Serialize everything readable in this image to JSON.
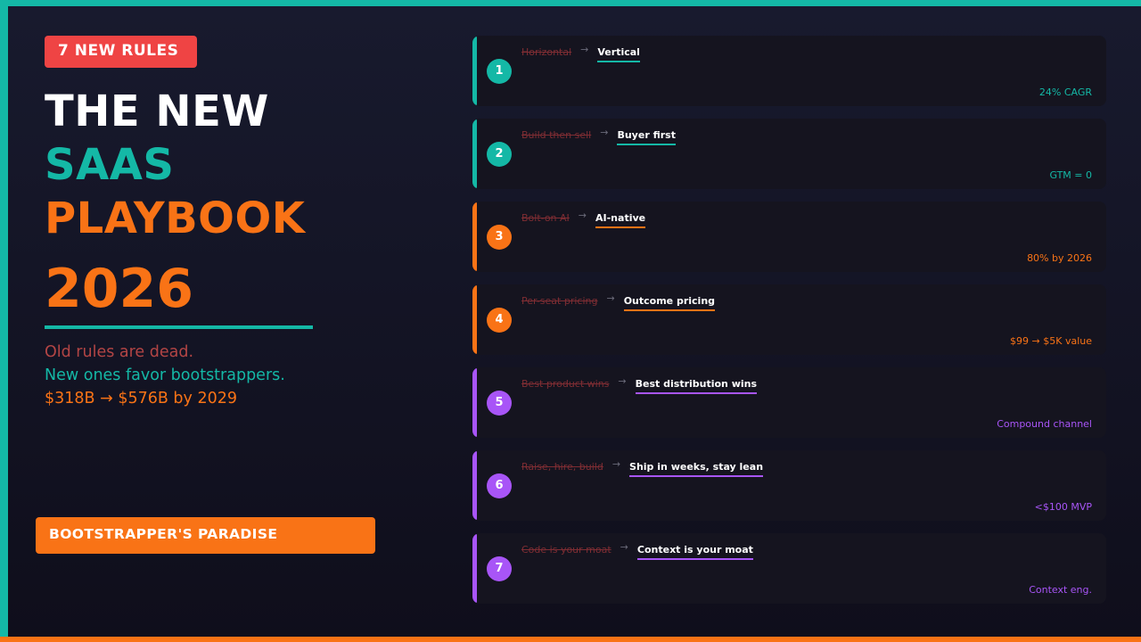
{
  "badge": "7 NEW RULES",
  "title": {
    "line1": "THE NEW",
    "line2": "SAAS",
    "line3": "PLAYBOOK",
    "year": "2026"
  },
  "subtitle": {
    "line1": "Old rules are dead.",
    "line2": "New ones favor bootstrappers.",
    "line3": "$318B → $576B by 2029"
  },
  "cta": "BOOTSTRAPPER'S PARADISE",
  "colors": {
    "teal": "#14b8a6",
    "orange": "#f97316",
    "purple": "#a855f7",
    "red": "#ef4444"
  },
  "arrow_glyph": "→",
  "rules": [
    {
      "num": "1",
      "old": "Horizontal",
      "new": "Vertical",
      "stat": "24% CAGR",
      "color": "#14b8a6"
    },
    {
      "num": "2",
      "old": "Build then sell",
      "new": "Buyer first",
      "stat": "GTM = 0",
      "color": "#14b8a6"
    },
    {
      "num": "3",
      "old": "Bolt-on AI",
      "new": "AI-native",
      "stat": "80% by 2026",
      "color": "#f97316"
    },
    {
      "num": "4",
      "old": "Per-seat pricing",
      "new": "Outcome pricing",
      "stat": "$99 → $5K value",
      "color": "#f97316"
    },
    {
      "num": "5",
      "old": "Best product wins",
      "new": "Best distribution wins",
      "stat": "Compound channel",
      "color": "#a855f7"
    },
    {
      "num": "6",
      "old": "Raise, hire, build",
      "new": "Ship in weeks, stay lean",
      "stat": "<$100 MVP",
      "color": "#a855f7"
    },
    {
      "num": "7",
      "old": "Code is your moat",
      "new": "Context is your moat",
      "stat": "Context eng.",
      "color": "#a855f7"
    }
  ]
}
